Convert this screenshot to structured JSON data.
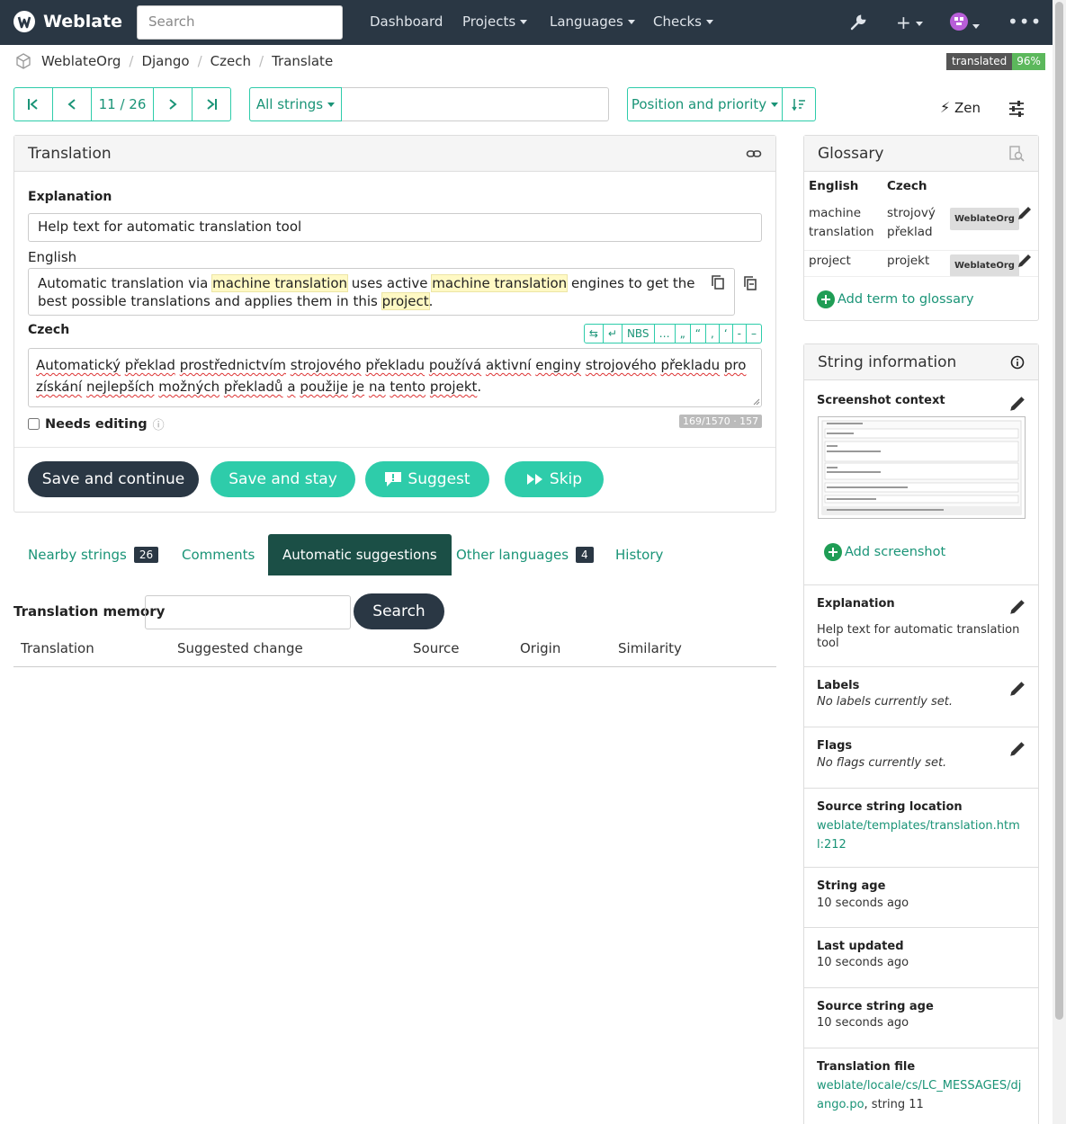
{
  "nav": {
    "brand": "Weblate",
    "search_placeholder": "Search",
    "items": [
      "Dashboard",
      "Projects",
      "Languages",
      "Checks"
    ]
  },
  "breadcrumbs": [
    "WeblateOrg",
    "Django",
    "Czech",
    "Translate"
  ],
  "status": {
    "label": "translated",
    "value": "96%"
  },
  "pager": {
    "position": "11 / 26"
  },
  "filter": {
    "label": "All strings",
    "query": ""
  },
  "sort": {
    "label": "Position and priority"
  },
  "zen_label": "Zen",
  "translation": {
    "header": "Translation",
    "explanation_label": "Explanation",
    "explanation": "Help text for automatic translation tool",
    "source_lang": "English",
    "source_parts": [
      "Automatic translation via ",
      "machine translation",
      " uses active ",
      "machine translation",
      " engines to get the best possible translations and applies them in this ",
      "project",
      "."
    ],
    "target_lang": "Czech",
    "target_words": [
      "Automatický",
      "překlad",
      "prostřednictvím",
      "strojového",
      "překladu",
      "používá",
      "aktivní",
      "enginy",
      "strojového",
      "překladu",
      "pro",
      "získání",
      "nejlepších",
      "možných",
      "překladů",
      "a",
      "použije",
      "je",
      "na",
      "tento",
      "projekt"
    ],
    "target_end": ".",
    "special_chars": [
      "NBS",
      "…",
      "„",
      "“",
      ",",
      "‘",
      "-",
      "–"
    ],
    "needs_editing": "Needs editing",
    "counter": "169/1570 · 157",
    "buttons": {
      "save_continue": "Save and continue",
      "save_stay": "Save and stay",
      "suggest": "Suggest",
      "skip": "Skip"
    }
  },
  "tabs": [
    {
      "label": "Nearby strings",
      "badge": "26"
    },
    {
      "label": "Comments"
    },
    {
      "label": "Automatic suggestions"
    },
    {
      "label": "Other languages",
      "badge": "4"
    },
    {
      "label": "History"
    }
  ],
  "memory": {
    "label": "Translation memory",
    "input_value": "",
    "search_button": "Search",
    "columns": [
      "Translation",
      "Suggested change",
      "Source",
      "Origin",
      "Similarity"
    ]
  },
  "glossary": {
    "header": "Glossary",
    "col_source": "English",
    "col_target": "Czech",
    "rows": [
      {
        "source": "machine translation",
        "target": "strojový překlad",
        "project": "WeblateOrg"
      },
      {
        "source": "project",
        "target": "projekt",
        "project": "WeblateOrg"
      }
    ],
    "add_term": "Add term to glossary"
  },
  "string_info": {
    "header": "String information",
    "screenshot_context": "Screenshot context",
    "add_screenshot": "Add screenshot",
    "explanation_title": "Explanation",
    "explanation": "Help text for automatic translation tool",
    "labels_title": "Labels",
    "labels_value": "No labels currently set.",
    "flags_title": "Flags",
    "flags_value": "No flags currently set.",
    "location_title": "Source string location",
    "location_value": "weblate/templates/translation.html:212",
    "string_age_title": "String age",
    "string_age": "10 seconds ago",
    "last_updated_title": "Last updated",
    "last_updated": "10 seconds ago",
    "source_age_title": "Source string age",
    "source_age": "10 seconds ago",
    "file_title": "Translation file",
    "file_link": "weblate/locale/cs/LC_MESSAGES/django.po",
    "file_suffix": ", string 11"
  },
  "colors": {
    "navbar": "#2a3744",
    "accent": "#2eccaa",
    "link": "#1a9477",
    "active_tab": "#1b4f46",
    "highlight": "#fff9c4"
  }
}
